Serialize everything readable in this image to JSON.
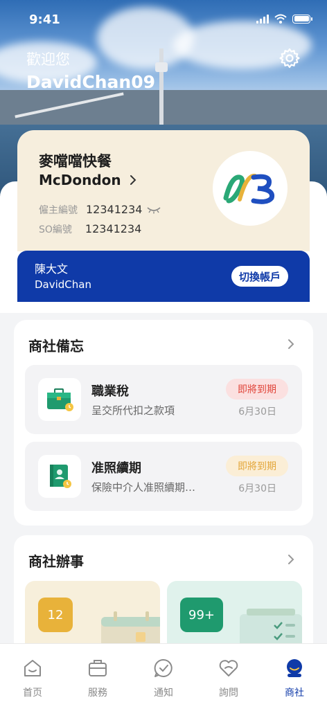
{
  "status_bar": {
    "time": "9:41"
  },
  "header": {
    "welcome": "歡迎您",
    "username": "DavidChan09"
  },
  "merchant": {
    "name_cn": "麥噹噹快餐",
    "name_en": "McDondon",
    "employer_no_label": "僱主編號",
    "employer_no": "12341234",
    "so_no_label": "SO編號",
    "so_no": "12341234"
  },
  "account": {
    "name_cn": "陳大文",
    "name_en": "DavidChan",
    "switch_label": "切換帳戶"
  },
  "memo": {
    "title": "商社備忘",
    "items": [
      {
        "title": "職業稅",
        "subtitle": "呈交所代扣之款項",
        "badge": "即將到期",
        "date": "6月30日",
        "badge_color": "#e0453a",
        "badge_bg": "#fbe0e0"
      },
      {
        "title": "准照續期",
        "subtitle": "保險中介人准照續期…",
        "badge": "即將到期",
        "date": "6月30日",
        "badge_color": "#e3a63a",
        "badge_bg": "#fbeed6"
      }
    ]
  },
  "business": {
    "title": "商社辦事",
    "cards": [
      {
        "count": "12",
        "color": "#e8b23a",
        "bg": "#f7efdb"
      },
      {
        "count": "99+",
        "color": "#1f9a6e",
        "bg": "#e0f2ec"
      }
    ]
  },
  "tabs": [
    {
      "label": "首页",
      "icon": "home-icon"
    },
    {
      "label": "服務",
      "icon": "briefcase-icon"
    },
    {
      "label": "通知",
      "icon": "chat-check-icon"
    },
    {
      "label": "詢問",
      "icon": "heart-chat-icon"
    },
    {
      "label": "商社",
      "icon": "merchant-profile-icon",
      "active": true
    }
  ],
  "colors": {
    "primary": "#0f3aa8",
    "merchant_card_bg": "#f6eedd"
  }
}
